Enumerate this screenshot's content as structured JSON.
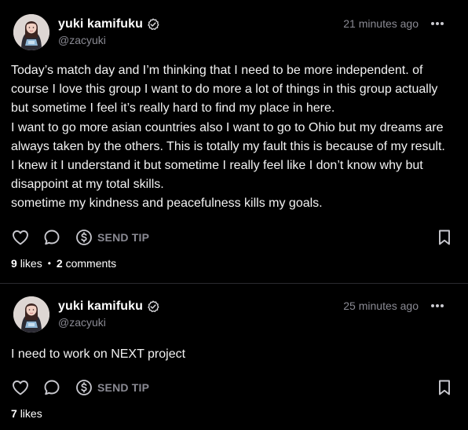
{
  "colors": {
    "background": "#000000",
    "text": "#ffffff",
    "muted": "#8a8a93",
    "divider": "#2a2a2f"
  },
  "posts": [
    {
      "author": {
        "display_name": "yuki kamifuku",
        "username": "@zacyuki",
        "verified": true,
        "avatar_icon": "avatar-photo"
      },
      "timestamp": "21 minutes ago",
      "body": [
        "Today’s match day and I’m thinking that I need to be more independent. of course I love this group I want to do more a lot of things in this group actually but sometime I feel it’s really hard to find my place in here.",
        "I want to go more asian countries also I want to go to Ohio but my dreams are always taken by the others. This is totally my fault this is because of my result. I knew it I understand it but sometime I really feel like I don’t know why but disap­point at my total skills.",
        "sometime my kindness and peacefulness kills my goals."
      ],
      "actions": {
        "tip_label": "SEND TIP",
        "icons": [
          "heart-icon",
          "comment-icon",
          "dollar-icon",
          "bookmark-icon"
        ]
      },
      "stats": {
        "likes_count": "9",
        "likes_label": "likes",
        "comments_count": "2",
        "comments_label": "comments"
      }
    },
    {
      "author": {
        "display_name": "yuki kamifuku",
        "username": "@zacyuki",
        "verified": true,
        "avatar_icon": "avatar-photo"
      },
      "timestamp": "25 minutes ago",
      "body": [
        "I need to work on NEXT project"
      ],
      "actions": {
        "tip_label": "SEND TIP",
        "icons": [
          "heart-icon",
          "comment-icon",
          "dollar-icon",
          "bookmark-icon"
        ]
      },
      "stats": {
        "likes_count": "7",
        "likes_label": "likes"
      }
    }
  ]
}
